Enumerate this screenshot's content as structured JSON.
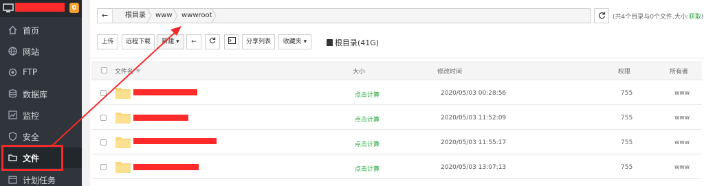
{
  "topbar": {
    "badge": "0",
    "accent_redaction": "#ff2a2a",
    "badge_color": "#f0a130"
  },
  "sidebar": {
    "items": [
      {
        "label": "首页",
        "icon": "home-icon"
      },
      {
        "label": "网站",
        "icon": "globe-icon"
      },
      {
        "label": "FTP",
        "icon": "ftp-icon"
      },
      {
        "label": "数据库",
        "icon": "database-icon"
      },
      {
        "label": "监控",
        "icon": "monitor-chart-icon"
      },
      {
        "label": "安全",
        "icon": "shield-icon"
      },
      {
        "label": "文件",
        "icon": "folder-icon",
        "active": true
      },
      {
        "label": "计划任务",
        "icon": "calendar-icon"
      }
    ]
  },
  "path": {
    "back_icon": "arrow-left-icon",
    "crumbs": [
      "根目录",
      "www",
      "wwwroot"
    ],
    "refresh_icon": "refresh-icon"
  },
  "summary": {
    "text": "(共4个目录与0个文件,大小:",
    "link": "获取",
    "close": ")"
  },
  "toolbar": {
    "upload": "上传",
    "remote_download": "远程下载",
    "new": "新建",
    "back_icon": "arrow-left-icon",
    "refresh_icon": "refresh-icon",
    "terminal_icon": "terminal-icon",
    "share_list": "分享列表",
    "favorites": "收藏夹",
    "disk": "根目录(41G)"
  },
  "table": {
    "headers": {
      "name": "文件名",
      "size": "大小",
      "mtime": "修改时间",
      "perm": "权限",
      "owner": "所有者"
    },
    "rows": [
      {
        "size": "点击计算",
        "mtime": "2020/05/03 00:28:56",
        "perm": "755",
        "owner": "www"
      },
      {
        "size": "点击计算",
        "mtime": "2020/05/03 11:52:09",
        "perm": "755",
        "owner": "www"
      },
      {
        "size": "点击计算",
        "mtime": "2020/05/03 11:55:17",
        "perm": "755",
        "owner": "www"
      },
      {
        "size": "点击计算",
        "mtime": "2020/05/03 13:07:13",
        "perm": "755",
        "owner": "www"
      }
    ]
  }
}
